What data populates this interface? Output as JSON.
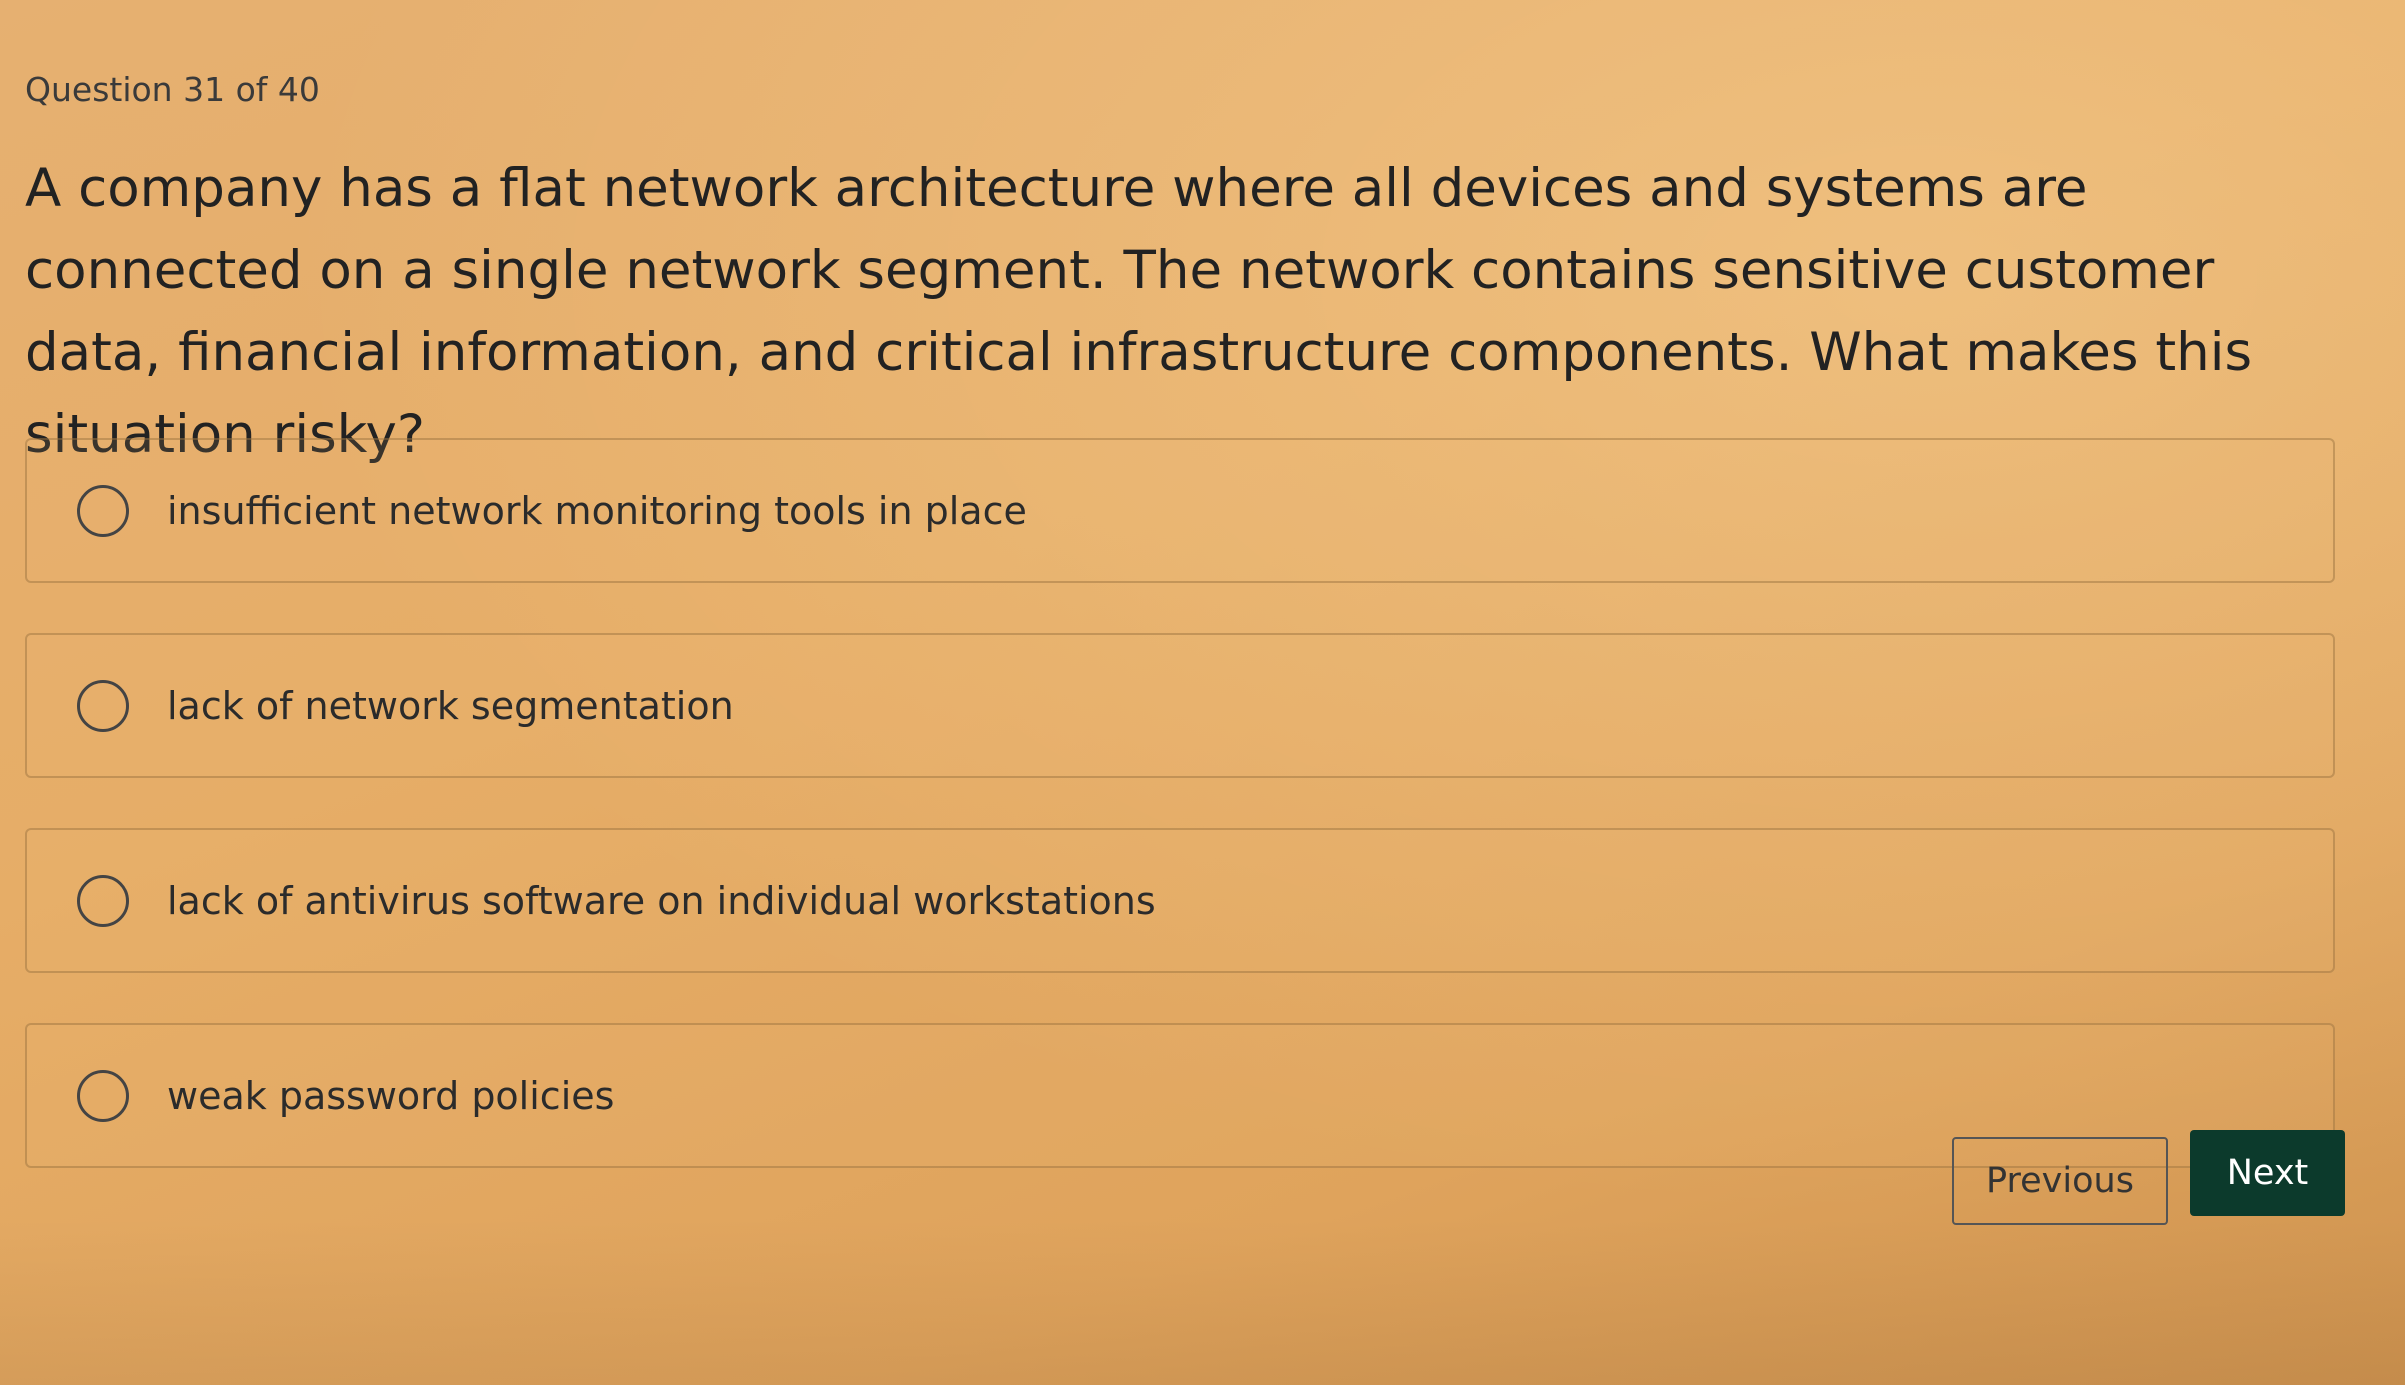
{
  "quiz": {
    "counter": "Question 31 of 40",
    "question": "A company has a flat network architecture where all devices and systems are connected on a single network segment. The network contains sensitive customer data, financial information, and critical infrastructure components. What makes this situation risky?",
    "options": [
      {
        "label": "insufficient network monitoring tools in place",
        "selected": false
      },
      {
        "label": "lack of network segmentation",
        "selected": false
      },
      {
        "label": "lack of antivirus software on individual workstations",
        "selected": false
      },
      {
        "label": "weak password policies",
        "selected": false
      }
    ]
  },
  "navigation": {
    "previous_label": "Previous",
    "next_label": "Next"
  },
  "colors": {
    "background": "#e6ad67",
    "next_button": "#0c3a2c",
    "text": "#222222"
  }
}
